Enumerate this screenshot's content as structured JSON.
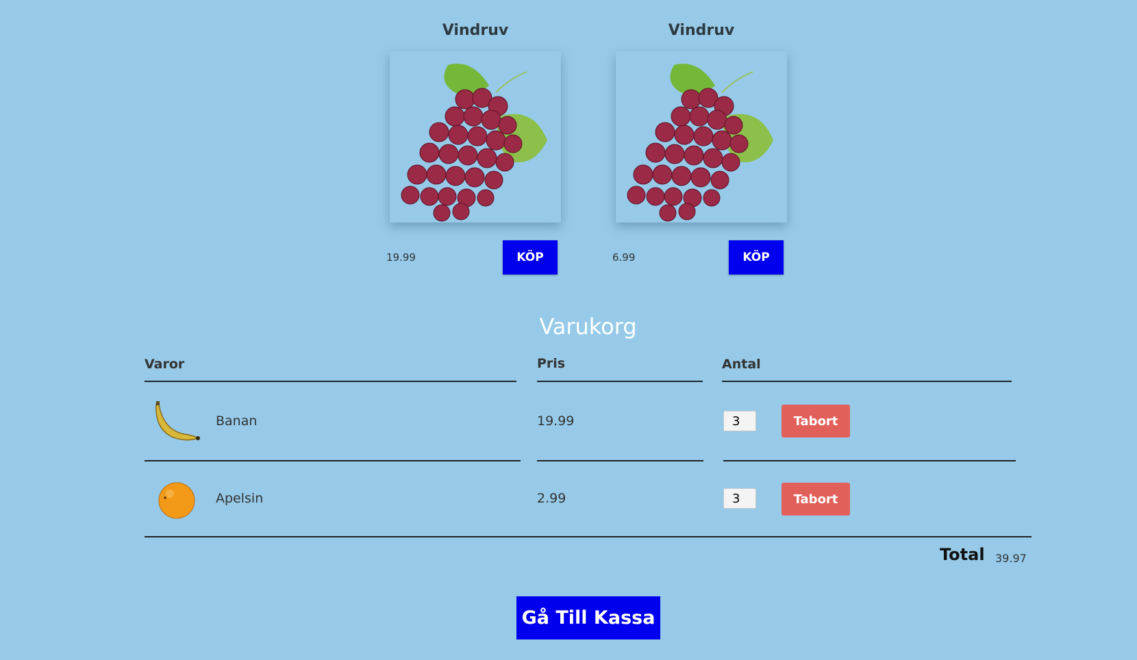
{
  "products": [
    {
      "name": "Vindruv",
      "price": "19.99",
      "buy_label": "KÖP",
      "image": "grapes-image"
    },
    {
      "name": "Vindruv",
      "price": "6.99",
      "buy_label": "KÖP",
      "image": "grapes-image"
    }
  ],
  "cart": {
    "title": "Varukorg",
    "headers": {
      "item": "Varor",
      "price": "Pris",
      "qty": "Antal"
    },
    "rows": [
      {
        "name": "Banan",
        "price": "19.99",
        "qty": "3",
        "remove_label": "Tabort",
        "image": "banana-image"
      },
      {
        "name": "Apelsin",
        "price": "2.99",
        "qty": "3",
        "remove_label": "Tabort",
        "image": "orange-image"
      }
    ],
    "total_label": "Total",
    "total_value": "39.97"
  },
  "checkout_label": "Gå Till Kassa",
  "colors": {
    "background": "#96cae8",
    "primary_button": "#0000ee",
    "remove_button": "#e2605a"
  }
}
